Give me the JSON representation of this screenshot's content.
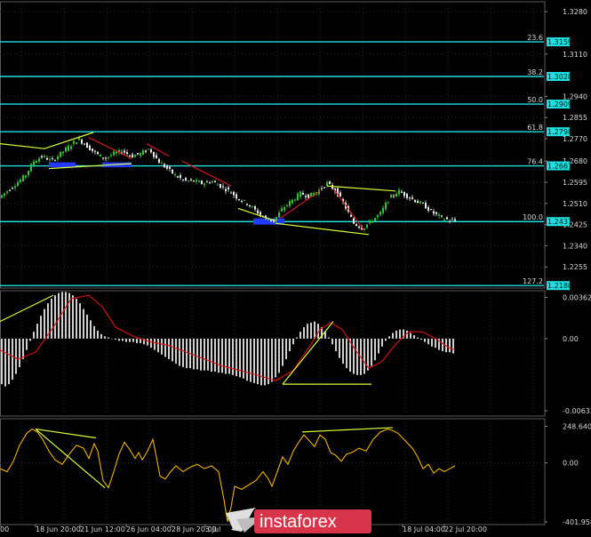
{
  "colors": {
    "background": "#000000",
    "grid": "#2a2a2a",
    "axis_text": "#d8d8d8",
    "bull_candle": "#2dc62d",
    "bear_candle": "#e6e6e6",
    "level_line": "#1ee0e0",
    "trend_line": "#d8ff3a",
    "resistance_line": "#e11b1b",
    "highlight": "#2439ff",
    "macd_hist": "#cfcfcf",
    "macd_signal": "#e01010",
    "cci_line": "#f0b400",
    "watermark_badge": "#d9354a"
  },
  "chart_data": [
    {
      "type": "candlestick",
      "title": "",
      "y_ticks": [
        "1.3280",
        "1.3110",
        "1.2940",
        "1.2855",
        "1.2770",
        "1.2680",
        "1.2595",
        "1.2510",
        "1.2425",
        "1.2340",
        "1.2255"
      ],
      "ylim": [
        1.217,
        1.332
      ],
      "fib_levels": [
        {
          "label": "23.6",
          "price": "1.3159"
        },
        {
          "label": "38.2",
          "price": "1.3020"
        },
        {
          "label": "50.0",
          "price": "1.2909"
        },
        {
          "label": "61.8",
          "price": "1.2798"
        },
        {
          "label": "76.4",
          "price": "1.2661"
        },
        {
          "label": "100.0",
          "price": "1.2437"
        },
        {
          "label": "127.2",
          "price": "1.2180"
        }
      ],
      "close_path": [
        [
          0,
          1.253
        ],
        [
          10,
          1.256
        ],
        [
          20,
          1.259
        ],
        [
          30,
          1.262
        ],
        [
          40,
          1.268
        ],
        [
          50,
          1.27
        ],
        [
          60,
          1.268
        ],
        [
          70,
          1.271
        ],
        [
          80,
          1.274
        ],
        [
          90,
          1.277
        ],
        [
          100,
          1.274
        ],
        [
          110,
          1.271
        ],
        [
          120,
          1.269
        ],
        [
          130,
          1.271
        ],
        [
          140,
          1.272
        ],
        [
          150,
          1.27
        ],
        [
          160,
          1.271
        ],
        [
          170,
          1.273
        ],
        [
          180,
          1.268
        ],
        [
          190,
          1.265
        ],
        [
          200,
          1.262
        ],
        [
          210,
          1.26
        ],
        [
          220,
          1.26
        ],
        [
          230,
          1.259
        ],
        [
          240,
          1.26
        ],
        [
          250,
          1.258
        ],
        [
          260,
          1.256
        ],
        [
          270,
          1.253
        ],
        [
          280,
          1.251
        ],
        [
          290,
          1.248
        ],
        [
          300,
          1.245
        ],
        [
          310,
          1.244
        ],
        [
          320,
          1.249
        ],
        [
          330,
          1.252
        ],
        [
          340,
          1.255
        ],
        [
          350,
          1.254
        ],
        [
          360,
          1.256
        ],
        [
          370,
          1.259
        ],
        [
          380,
          1.256
        ],
        [
          390,
          1.25
        ],
        [
          400,
          1.243
        ],
        [
          410,
          1.241
        ],
        [
          420,
          1.244
        ],
        [
          430,
          1.247
        ],
        [
          440,
          1.253
        ],
        [
          450,
          1.256
        ],
        [
          460,
          1.254
        ],
        [
          470,
          1.252
        ],
        [
          480,
          1.25
        ],
        [
          490,
          1.247
        ],
        [
          500,
          1.245
        ],
        [
          510,
          1.244
        ]
      ],
      "trend_lines": [
        {
          "a": [
            0,
            1.275
          ],
          "b": [
            50,
            1.273
          ]
        },
        {
          "a": [
            50,
            1.273
          ],
          "b": [
            105,
            1.2795
          ]
        },
        {
          "a": [
            55,
            1.265
          ],
          "b": [
            148,
            1.267
          ]
        },
        {
          "a": [
            268,
            1.249
          ],
          "b": [
            310,
            1.244
          ]
        },
        {
          "a": [
            310,
            1.243
          ],
          "b": [
            415,
            1.2385
          ]
        },
        {
          "a": [
            368,
            1.258
          ],
          "b": [
            445,
            1.256
          ]
        }
      ],
      "resistance_lines": [
        {
          "a": [
            100,
            1.2775
          ],
          "b": [
            148,
            1.269
          ]
        },
        {
          "a": [
            165,
            1.275
          ],
          "b": [
            190,
            1.27
          ]
        },
        {
          "a": [
            205,
            1.268
          ],
          "b": [
            260,
            1.258
          ]
        },
        {
          "a": [
            315,
            1.245
          ],
          "b": [
            360,
            1.256
          ]
        },
        {
          "a": [
            375,
            1.257
          ],
          "b": [
            410,
            1.24
          ]
        }
      ],
      "highlights": [
        {
          "x0": 55,
          "x1": 85,
          "p_hi": 1.2675,
          "p_lo": 1.2655
        },
        {
          "x0": 115,
          "x1": 148,
          "p_hi": 1.2675,
          "p_lo": 1.2655
        },
        {
          "x0": 285,
          "x1": 320,
          "p_hi": 1.245,
          "p_lo": 1.2425
        }
      ]
    },
    {
      "type": "bar",
      "title": "",
      "y_ticks": [
        "0.00362",
        "0.00",
        "-0.00633"
      ],
      "ylim": [
        -0.0068,
        0.0042
      ],
      "x": [
        2,
        6,
        10,
        14,
        18,
        22,
        26,
        30,
        34,
        38,
        42,
        46,
        50,
        54,
        58,
        62,
        66,
        70,
        74,
        78,
        82,
        86,
        90,
        94,
        98,
        102,
        106,
        110,
        114,
        118,
        122,
        126,
        130,
        134,
        138,
        142,
        146,
        150,
        154,
        158,
        162,
        166,
        170,
        174,
        178,
        182,
        186,
        190,
        194,
        198,
        202,
        206,
        210,
        214,
        218,
        222,
        226,
        230,
        234,
        238,
        242,
        246,
        250,
        254,
        258,
        262,
        266,
        270,
        274,
        278,
        282,
        286,
        290,
        294,
        298,
        302,
        306,
        310,
        314,
        318,
        322,
        326,
        330,
        334,
        338,
        342,
        346,
        350,
        354,
        358,
        362,
        366,
        370,
        374,
        378,
        382,
        386,
        390,
        394,
        398,
        402,
        406,
        410,
        414,
        418,
        422,
        426,
        430,
        434,
        438,
        442,
        446,
        450,
        454,
        458,
        462,
        466,
        470,
        474,
        478,
        482,
        486,
        490,
        494,
        498,
        502,
        506,
        510
      ],
      "values": [
        -0.004,
        -0.0042,
        -0.004,
        -0.0036,
        -0.0031,
        -0.0025,
        -0.0018,
        -0.001,
        -0.0002,
        0.0006,
        0.0013,
        0.002,
        0.0026,
        0.0031,
        0.0035,
        0.0038,
        0.004,
        0.0041,
        0.0041,
        0.004,
        0.0038,
        0.0035,
        0.0031,
        0.0026,
        0.0021,
        0.0016,
        0.0011,
        0.0007,
        0.0004,
        0.0002,
        0.0001,
        0.0,
        -0.0001,
        -0.0002,
        -0.0002,
        -0.0003,
        -0.0003,
        -0.0003,
        -0.0004,
        -0.0004,
        -0.0005,
        -0.0006,
        -0.0008,
        -0.001,
        -0.0012,
        -0.0014,
        -0.0016,
        -0.0018,
        -0.002,
        -0.0022,
        -0.0024,
        -0.0025,
        -0.0026,
        -0.0026,
        -0.0027,
        -0.0027,
        -0.0028,
        -0.0028,
        -0.0028,
        -0.0029,
        -0.0029,
        -0.003,
        -0.003,
        -0.0031,
        -0.0031,
        -0.0032,
        -0.0033,
        -0.0034,
        -0.0035,
        -0.0037,
        -0.0038,
        -0.0039,
        -0.004,
        -0.0041,
        -0.0041,
        -0.004,
        -0.0038,
        -0.0034,
        -0.003,
        -0.0024,
        -0.0018,
        -0.0011,
        -0.0005,
        0.0001,
        0.0006,
        0.001,
        0.0013,
        0.0014,
        0.0015,
        0.0013,
        0.001,
        0.0006,
        0.0001,
        -0.0005,
        -0.0011,
        -0.0017,
        -0.0022,
        -0.0026,
        -0.0029,
        -0.0031,
        -0.0032,
        -0.0032,
        -0.0031,
        -0.0028,
        -0.0024,
        -0.0019,
        -0.0013,
        -0.0007,
        -0.0002,
        0.0002,
        0.0005,
        0.0007,
        0.0008,
        0.0008,
        0.0007,
        0.0005,
        0.0003,
        0.0001,
        -0.0001,
        -0.0003,
        -0.0005,
        -0.0007,
        -0.0008,
        -0.001,
        -0.0011,
        -0.0012,
        -0.0012,
        -0.0013
      ],
      "signal": [
        [
          0,
          -0.001
        ],
        [
          20,
          -0.0018
        ],
        [
          40,
          -0.0012
        ],
        [
          60,
          0.001
        ],
        [
          80,
          0.0035
        ],
        [
          100,
          0.0038
        ],
        [
          115,
          0.0028
        ],
        [
          130,
          0.001
        ],
        [
          150,
          0.0002
        ],
        [
          170,
          -0.0003
        ],
        [
          190,
          -0.0006
        ],
        [
          210,
          -0.0012
        ],
        [
          230,
          -0.0018
        ],
        [
          250,
          -0.0024
        ],
        [
          270,
          -0.0028
        ],
        [
          290,
          -0.0032
        ],
        [
          310,
          -0.0037
        ],
        [
          330,
          -0.0028
        ],
        [
          350,
          -0.0005
        ],
        [
          360,
          0.0008
        ],
        [
          372,
          0.0014
        ],
        [
          385,
          0.0008
        ],
        [
          400,
          -0.001
        ],
        [
          415,
          -0.0026
        ],
        [
          430,
          -0.002
        ],
        [
          445,
          -0.0005
        ],
        [
          460,
          0.0006
        ],
        [
          475,
          0.0006
        ],
        [
          490,
          0.0
        ],
        [
          505,
          -0.0008
        ],
        [
          512,
          -0.001
        ]
      ],
      "trend_lines": [
        {
          "a": [
            0,
            0.0015
          ],
          "b": [
            60,
            0.0038
          ]
        },
        {
          "a": [
            318,
            -0.004
          ],
          "b": [
            418,
            -0.004
          ]
        },
        {
          "a": [
            318,
            -0.004
          ],
          "b": [
            375,
            0.0015
          ]
        }
      ]
    },
    {
      "type": "line",
      "title": "",
      "y_ticks": [
        "248.6406",
        "0.00",
        "-401.958"
      ],
      "ylim": [
        -420,
        300
      ],
      "series": [
        {
          "values": [
            [
              0,
              -40
            ],
            [
              8,
              -60
            ],
            [
              15,
              10
            ],
            [
              22,
              120
            ],
            [
              30,
              200
            ],
            [
              36,
              230
            ],
            [
              42,
              210
            ],
            [
              48,
              160
            ],
            [
              55,
              80
            ],
            [
              62,
              20
            ],
            [
              70,
              -10
            ],
            [
              78,
              60
            ],
            [
              86,
              120
            ],
            [
              94,
              100
            ],
            [
              100,
              30
            ],
            [
              106,
              130
            ],
            [
              110,
              80
            ],
            [
              116,
              -120
            ],
            [
              122,
              -170
            ],
            [
              128,
              -60
            ],
            [
              134,
              60
            ],
            [
              140,
              140
            ],
            [
              146,
              90
            ],
            [
              152,
              30
            ],
            [
              156,
              70
            ],
            [
              160,
              20
            ],
            [
              166,
              80
            ],
            [
              172,
              160
            ],
            [
              176,
              40
            ],
            [
              180,
              -90
            ],
            [
              186,
              -110
            ],
            [
              192,
              -60
            ],
            [
              198,
              -20
            ],
            [
              206,
              -60
            ],
            [
              214,
              -30
            ],
            [
              222,
              -10
            ],
            [
              230,
              -40
            ],
            [
              238,
              -20
            ],
            [
              246,
              -60
            ],
            [
              252,
              -250
            ],
            [
              256,
              -400
            ],
            [
              260,
              -300
            ],
            [
              264,
              -160
            ],
            [
              272,
              -180
            ],
            [
              280,
              -150
            ],
            [
              288,
              -120
            ],
            [
              296,
              -60
            ],
            [
              302,
              -110
            ],
            [
              306,
              -160
            ],
            [
              312,
              -60
            ],
            [
              318,
              40
            ],
            [
              324,
              -10
            ],
            [
              330,
              80
            ],
            [
              336,
              140
            ],
            [
              342,
              190
            ],
            [
              348,
              150
            ],
            [
              354,
              110
            ],
            [
              360,
              190
            ],
            [
              366,
              160
            ],
            [
              372,
              70
            ],
            [
              378,
              50
            ],
            [
              384,
              10
            ],
            [
              390,
              60
            ],
            [
              396,
              70
            ],
            [
              404,
              100
            ],
            [
              412,
              80
            ],
            [
              420,
              160
            ],
            [
              428,
              210
            ],
            [
              436,
              230
            ],
            [
              442,
              220
            ],
            [
              448,
              200
            ],
            [
              456,
              150
            ],
            [
              464,
              100
            ],
            [
              470,
              40
            ],
            [
              476,
              -40
            ],
            [
              482,
              -10
            ],
            [
              488,
              -70
            ],
            [
              494,
              -40
            ],
            [
              500,
              -60
            ],
            [
              506,
              -40
            ],
            [
              512,
              -20
            ]
          ]
        }
      ],
      "trend_lines": [
        {
          "a": [
            40,
            230
          ],
          "b": [
            108,
            170
          ]
        },
        {
          "a": [
            40,
            230
          ],
          "b": [
            118,
            -170
          ]
        },
        {
          "a": [
            340,
            210
          ],
          "b": [
            442,
            240
          ]
        }
      ]
    }
  ],
  "x_axis": {
    "ticks": [
      {
        "label": "00",
        "x": 0
      },
      {
        "label": "18 Jun 20:00",
        "x": 40
      },
      {
        "label": "21 Jun 12:00",
        "x": 90
      },
      {
        "label": "26 Jun 04:00",
        "x": 142
      },
      {
        "label": "28 Jun 20:00",
        "x": 193
      },
      {
        "label": "3 Jul",
        "x": 231
      },
      {
        "label": "18 Jul 04:00",
        "x": 453
      },
      {
        "label": "22 Jul 20:00",
        "x": 500
      }
    ]
  },
  "watermark": {
    "brand": "instaforex",
    "icon": "instaforex-logo-icon"
  }
}
